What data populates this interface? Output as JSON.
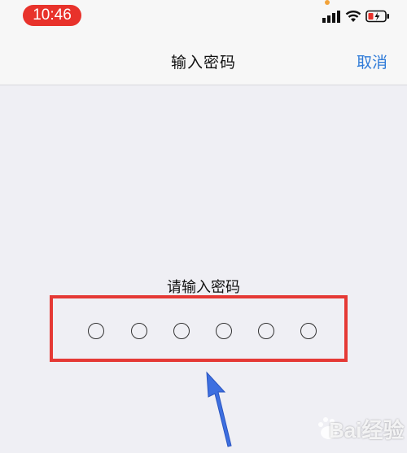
{
  "status_bar": {
    "time": "10:46",
    "time_pill_color": "#e8322b",
    "signal_icon": "cellular-signal-icon",
    "wifi_icon": "wifi-icon",
    "battery_icon": "battery-charging-icon"
  },
  "nav": {
    "title": "输入密码",
    "cancel_label": "取消",
    "accent_color": "#2f7bd8"
  },
  "passcode": {
    "prompt": "请输入密码",
    "digit_count": 6,
    "entered_count": 0,
    "highlight_color": "#e53935"
  },
  "annotation": {
    "arrow_icon": "blue-arrow-icon",
    "arrow_color": "#3d6fe0"
  },
  "watermark": {
    "text": "Bai经验"
  }
}
